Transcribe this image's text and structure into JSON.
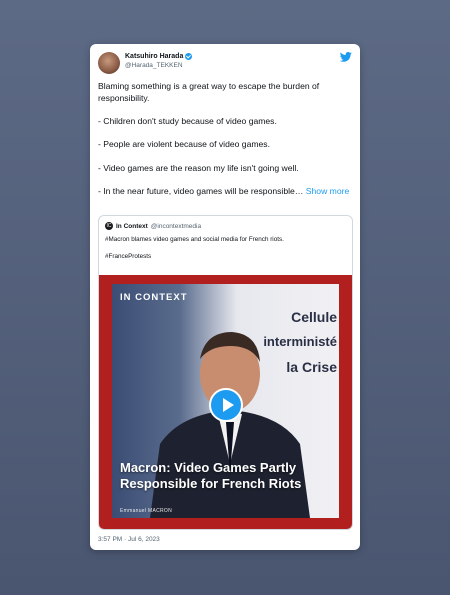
{
  "tweet": {
    "author_name": "Katsuhiro Harada",
    "author_handle": "@Harada_TEKKEN",
    "paragraphs": [
      "Blaming something is a great way to escape the burden of responsibility.",
      "- Children don't study because of video games.",
      "- People are violent because of video games.",
      "- Video games are the reason my life isn't going well."
    ],
    "last_paragraph": "- In the near future, video games will be responsible…",
    "show_more": "Show more",
    "timestamp": "3:57 PM · Jul 6, 2023"
  },
  "quote": {
    "avatar_letter": "IC",
    "name": "In Context",
    "handle": "@incontextmedia",
    "line1": "#Macron blames video games and social media for French riots.",
    "line2": "#FranceProtests"
  },
  "media": {
    "brand": "IN CONTEXT",
    "bg_text_1": "Cellule",
    "bg_text_2": "interministé",
    "bg_text_3": "la Crise",
    "caption": "Macron: Video Games Partly Responsible for French Riots",
    "lower_tag": "Emmanuel MACRON",
    "accent_color": "#b21f1f"
  },
  "colors": {
    "link": "#1d9bf0",
    "verified": "#1d9bf0"
  },
  "icons": [
    "verified-badge-icon",
    "twitter-bird-icon",
    "play-icon"
  ]
}
